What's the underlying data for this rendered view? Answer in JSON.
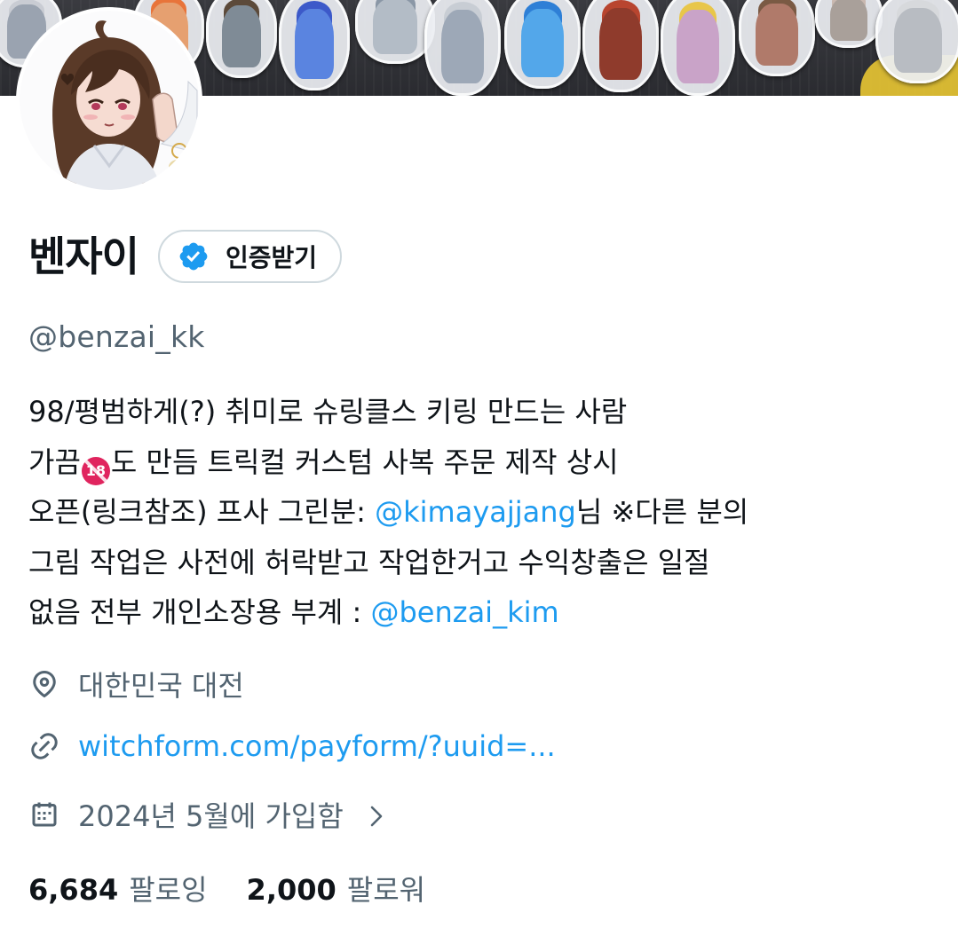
{
  "profile": {
    "display_name": "벤자이",
    "verify_button_label": "인증받기",
    "handle": "@benzai_kk"
  },
  "bio": {
    "line1": "98/평범하게(?) 취미로 슈링클스 키링 만드는 사람",
    "line2_a": "가끔",
    "line2_emoji": "18",
    "line2_b": "도 만듬 트릭컬 커스텀 사복 주문 제작 상시",
    "line3_a": "오픈(링크참조) 프사 그린분: ",
    "line3_mention": "@kimayajjang",
    "line3_b": "님 ※다른 분의",
    "line4": "그림 작업은 사전에 허락받고 작업한거고 수익창출은 일절",
    "line5_a": "없음 전부 개인소장용 부계 : ",
    "line5_mention": "@benzai_kim"
  },
  "meta": {
    "location": "대한민국 대전",
    "location_icon": "location-pin-icon",
    "link": "witchform.com/payform/?uuid=...",
    "link_icon": "link-icon",
    "joined": "2024년 5월에 가입함",
    "joined_icon": "calendar-icon"
  },
  "stats": {
    "following_count": "6,684",
    "following_label": "팔로잉",
    "followers_count": "2,000",
    "followers_label": "팔로워"
  },
  "colors": {
    "accent": "#1d9bf0",
    "secondary_text": "#536471",
    "primary_text": "#0f1419",
    "border": "#cfd9de"
  }
}
